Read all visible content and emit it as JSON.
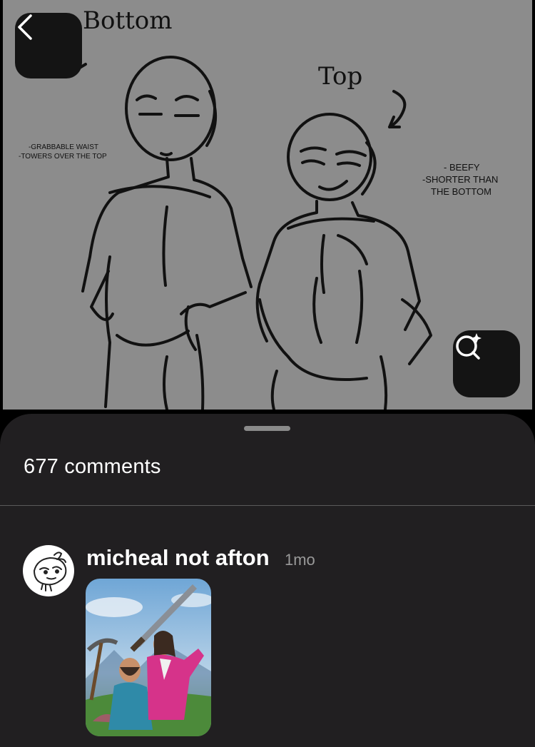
{
  "pin": {
    "annotations": {
      "bottom_title": "Bottom",
      "top_title": "Top",
      "bottom_notes": [
        "-GRABBABLE WAIST",
        "-TOWERS OVER THE TOP"
      ],
      "top_notes": [
        "- BEEFY",
        "-SHORTER THAN",
        "THE BOTTOM"
      ]
    },
    "back_icon": "chevron-left-icon",
    "lens_icon": "visual-search-icon"
  },
  "comments_sheet": {
    "count_label": "677 comments",
    "comments": [
      {
        "username": "micheal not afton",
        "time": "1mo",
        "avatar_icon": "sketch-creature-avatar",
        "attachment": "movie-still-image"
      }
    ]
  },
  "colors": {
    "image_bg": "#8c8c8c",
    "sheet_bg": "#211f21",
    "button_bg": "#141414"
  }
}
